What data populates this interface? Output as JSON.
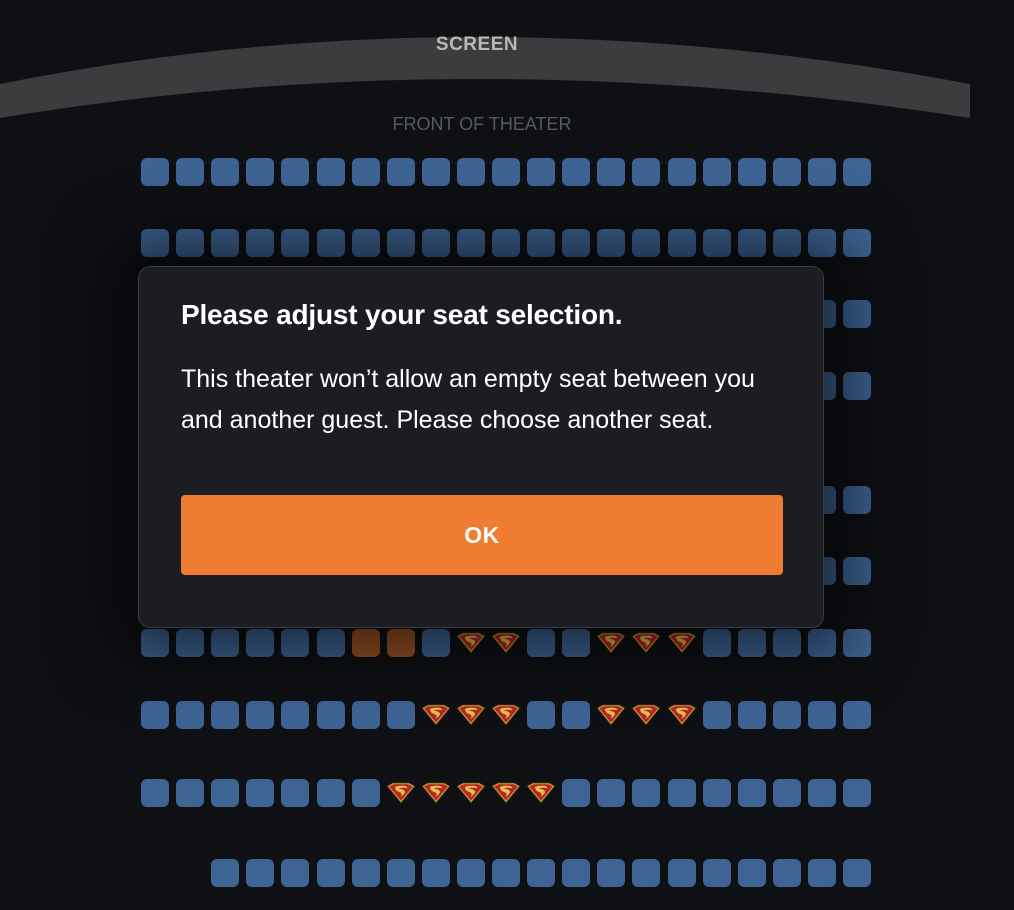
{
  "header": {
    "screen_label": "SCREEN",
    "front_label": "FRONT OF THEATER"
  },
  "colors": {
    "background": "#0e1014",
    "seat_available": "#3e6494",
    "seat_selected": "#9a5224",
    "accent_button": "#ee7c31",
    "screen_band": "#3c3c3e",
    "modal_bg": "#1b1d22"
  },
  "seat_legend": {
    "A": "available",
    "S": "selected",
    "X": "taken (superhero shield icon)"
  },
  "seat_icon_taken": "superhero-shield-icon",
  "rows": [
    {
      "id": "row-1",
      "seats": "AAAAAAAAAAAAAAAAAAAAA"
    },
    {
      "id": "row-2",
      "seats": "AAAAAAAAAAAAAAAAAAAAA"
    },
    {
      "id": "row-3",
      "seats": "AAAAAAAAAAAAAAAAAAAAA"
    },
    {
      "id": "row-4",
      "seats": "AAAAAAAAAAAAAAAAAAAAA"
    },
    {
      "id": "row-5",
      "seats": "AAAAAAAAAAAAAAAAAAAAA"
    },
    {
      "id": "row-6",
      "seats": "AAAAAAAAAAAAAAAAAAAAA"
    },
    {
      "id": "row-7",
      "seats": "AAAAAASSAXXAAXXXAAAAA"
    },
    {
      "id": "row-8",
      "seats": "AAAAAAAAXXXAAXXXAAAAA"
    },
    {
      "id": "row-9",
      "seats": "AAAAAAAXXXXXAAAAAAAAA"
    },
    {
      "id": "row-10",
      "seats": "AAAAAAAAAAAAAAAAAAA"
    }
  ],
  "modal": {
    "title": "Please adjust your seat selection.",
    "body": "This theater won’t allow an empty seat between you and another guest. Please choose another seat.",
    "ok_label": "OK"
  }
}
